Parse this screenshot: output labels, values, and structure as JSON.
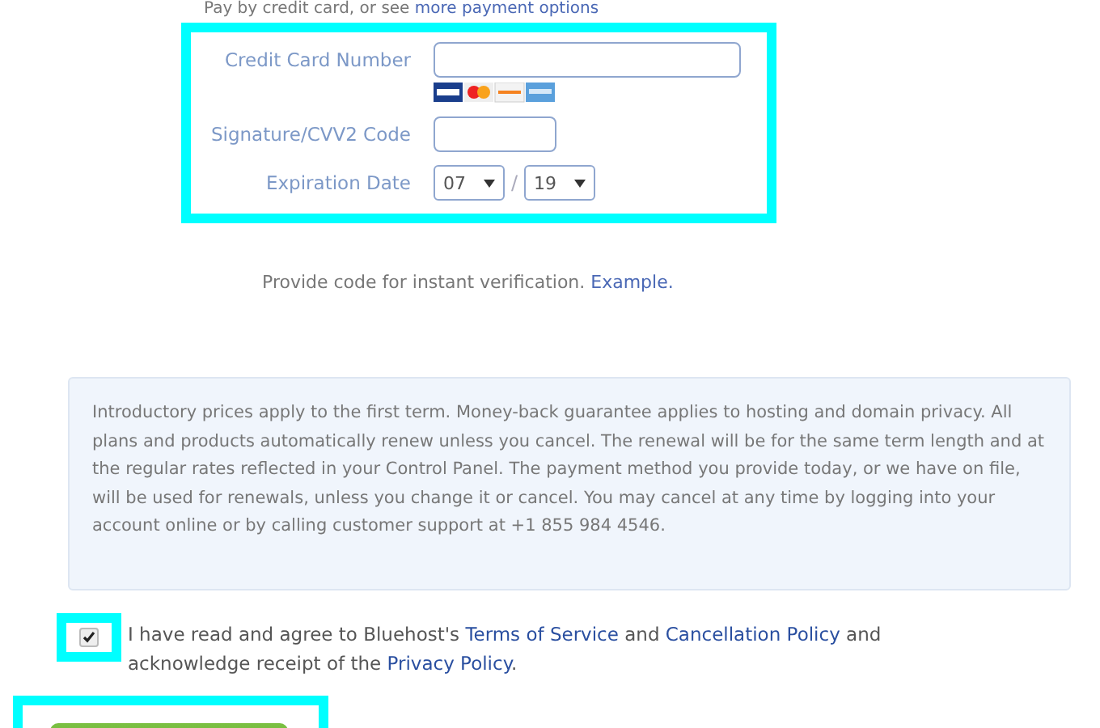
{
  "intro": [
    {
      "kind": "text",
      "text": "Pay by credit card, or see "
    },
    {
      "kind": "link",
      "text": "more payment options"
    }
  ],
  "fields": [
    {
      "kind": "card",
      "label": "Credit Card Number"
    },
    {
      "kind": "code",
      "label": "Signature/CVV2 Code"
    },
    {
      "kind": "date",
      "label": "Expiration Date",
      "month": "07",
      "separator": "/",
      "year": "19"
    }
  ],
  "verification": [
    {
      "kind": "text",
      "text": "Provide code for instant verification. "
    },
    {
      "kind": "link",
      "text": "Example."
    }
  ],
  "notice": "Introductory prices apply to the first term. Money-back guarantee applies to hosting and domain privacy. All plans and products automatically renew unless you cancel. The renewal will be for the same term length and at the regular rates reflected in your Control Panel. The payment method you provide today, or we have on file, will be used for renewals, unless you change it or cancel. You may cancel at any time by logging into your account online or by calling customer support at +1 855 984 4546.",
  "agreement": {
    "checked": true,
    "parts": [
      {
        "kind": "text",
        "text": "I have read and agree to Bluehost's "
      },
      {
        "kind": "link",
        "text": "Terms of Service"
      },
      {
        "kind": "text",
        "text": " and "
      },
      {
        "kind": "link",
        "text": "Cancellation Policy"
      },
      {
        "kind": "text",
        "text": " and acknowledge receipt of the "
      },
      {
        "kind": "link",
        "text": "Privacy Policy"
      },
      {
        "kind": "text",
        "text": "."
      }
    ]
  }
}
